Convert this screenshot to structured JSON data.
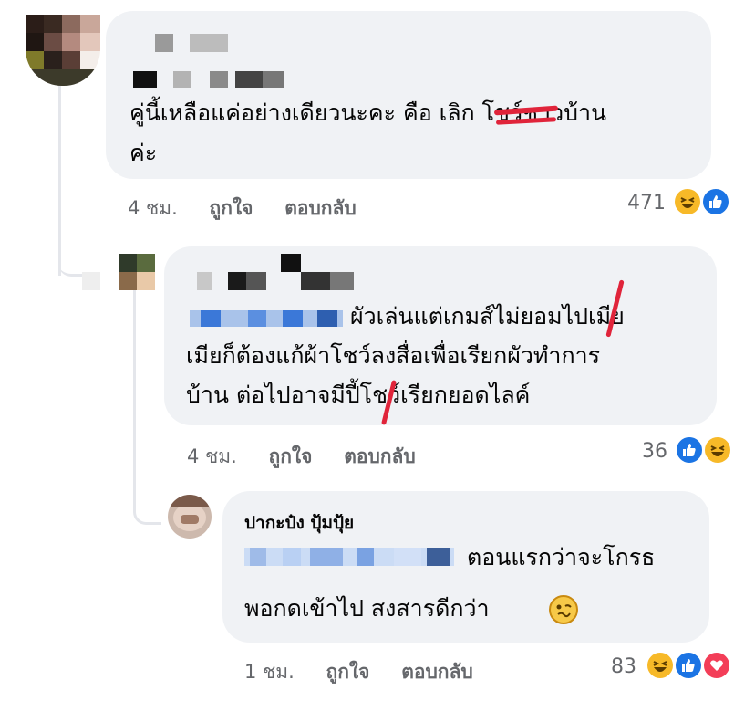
{
  "comments": [
    {
      "text_lines": [
        "คู่นี้เหลือแค่อย่างเดียวนะคะ คือ เลิก โชว์ชาวบ้าน",
        "ค่ะ"
      ],
      "time": "4 ชม.",
      "like_label": "ถูกใจ",
      "reply_label": "ตอบกลับ",
      "reaction_count": "471",
      "reactions": [
        "haha-icon",
        "like-icon"
      ]
    },
    {
      "text_lines": [
        "ผัวเล่นแต่เกมส์ไม่ยอมไปเมีย",
        "เมียก็ต้องแก้ผ้าโชว์ลงสื่อเพื่อเรียกผัวทำการ",
        "บ้าน ต่อไปอาจมีปี้โชว์เรียกยอดไลค์"
      ],
      "time": "4 ชม.",
      "like_label": "ถูกใจ",
      "reply_label": "ตอบกลับ",
      "reaction_count": "36",
      "reactions": [
        "like-icon",
        "haha-icon"
      ]
    },
    {
      "author": "ปากะป๋ง ปุ้มปุ้ย",
      "text_lines": [
        "ตอนแรกว่าจะโกรธ",
        "พอกดเข้าไป สงสารดีกว่า"
      ],
      "emoji": "woozy-face-icon",
      "time": "1 ชม.",
      "like_label": "ถูกใจ",
      "reply_label": "ตอบกลับ",
      "reaction_count": "83",
      "reactions": [
        "haha-icon",
        "like-icon",
        "love-icon"
      ]
    }
  ],
  "colors": {
    "bubble": "#f0f2f5",
    "meta_text": "#65676b",
    "thread_line": "#e4e6eb",
    "like_blue": "#1b74e4",
    "haha_yellow": "#f7b928",
    "love_red": "#f33e58",
    "censor_red": "#e0243a"
  }
}
